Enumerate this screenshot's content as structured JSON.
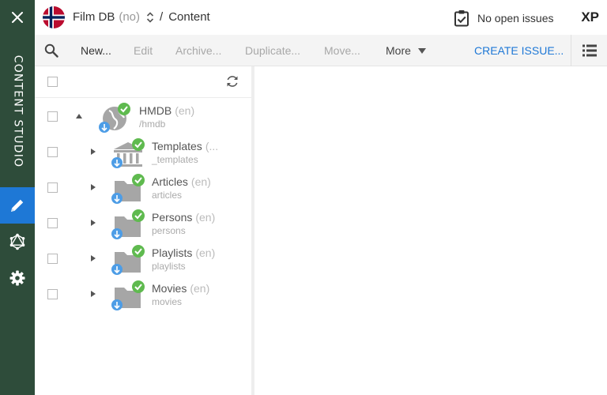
{
  "app": {
    "rail_title": "CONTENT STUDIO",
    "accent_color": "#1e78d6",
    "rail_color": "#2e4c3a"
  },
  "header": {
    "project_name": "Film DB",
    "project_lang": "(no)",
    "separator": "/",
    "section": "Content",
    "issues_label": "No open issues",
    "logo": "XP"
  },
  "toolbar": {
    "new": "New...",
    "edit": "Edit",
    "archive": "Archive...",
    "duplicate": "Duplicate...",
    "move": "Move...",
    "more": "More",
    "create_issue": "CREATE ISSUE..."
  },
  "tree": {
    "root": {
      "name": "HMDB",
      "lang": "(en)",
      "path": "/hmdb",
      "icon": "site-icon"
    },
    "children": [
      {
        "name": "Templates",
        "lang": "(...",
        "path": "_templates",
        "icon": "templates-icon"
      },
      {
        "name": "Articles",
        "lang": "(en)",
        "path": "articles",
        "icon": "folder-icon"
      },
      {
        "name": "Persons",
        "lang": "(en)",
        "path": "persons",
        "icon": "folder-icon"
      },
      {
        "name": "Playlists",
        "lang": "(en)",
        "path": "playlists",
        "icon": "folder-icon"
      },
      {
        "name": "Movies",
        "lang": "(en)",
        "path": "movies",
        "icon": "folder-icon"
      }
    ]
  }
}
